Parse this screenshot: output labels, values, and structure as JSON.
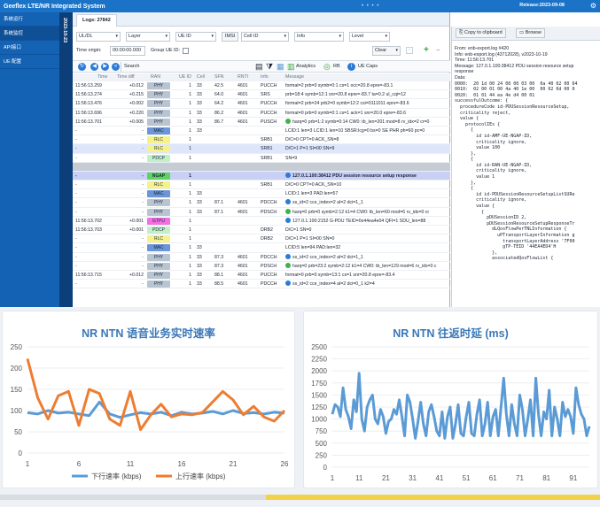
{
  "app": {
    "title": "Geeflex LTE/NR Integrated System",
    "release": "Release:2023-09-08",
    "title_dots": "• • • •"
  },
  "sidebar": {
    "items": [
      {
        "label": "系统运行"
      },
      {
        "label": "系统监控",
        "active": true
      },
      {
        "label": "API接口"
      },
      {
        "label": "UE 配置"
      }
    ]
  },
  "date_strip": "2023-10-23",
  "tab": {
    "label": "Logs: 27842"
  },
  "filters": {
    "uldl": "UL/DL",
    "layer": "Layer",
    "ue_id": "UE ID",
    "imsi_label": "IMSI",
    "cell_id": "Cell ID",
    "info": "Info",
    "level": "Level"
  },
  "time_origin": {
    "label": "Time origin:",
    "value": "00:00:00.000",
    "group_label": "Group UE ID:",
    "clear": "Clear"
  },
  "toolbar": {
    "search": "Search",
    "analytics": "Analytics",
    "rb": "RB",
    "ue_caps": "UE Caps"
  },
  "table": {
    "columns": [
      "Time",
      "Time diff",
      "RAN",
      "UE ID",
      "Cell",
      "SFN",
      "RNTI",
      "Info",
      "Message"
    ],
    "layer_colors": {
      "PHY": "#b9c4d2",
      "MAC": "#6b95d6",
      "RLC": "#f5f28e",
      "PDCP": "#c1f0c8",
      "NGAP": "#5ed45e",
      "GTPU": "#f26ee2"
    },
    "rows": [
      {
        "time": "11:56:13.259",
        "diff": "+0.012",
        "ran": "PHY",
        "ue": "1",
        "cell": "33",
        "sfn": "42.5",
        "rnti": "4601",
        "info": "PUCCH",
        "msg": "format=2 prb=0 symb=0:1 cs=1 occ=20.8 epre=-83.1"
      },
      {
        "time": "11:56:13.274",
        "diff": "+0.215",
        "ran": "PHY",
        "ue": "1",
        "cell": "33",
        "sfn": "64.0",
        "rnti": "4601",
        "info": "SRS",
        "msg": "prb=18:4 symb=12:1 snr=20.8 epre=-83.7 ta=0.2 ul_cqi=12"
      },
      {
        "time": "11:56:13.476",
        "diff": "+0.002",
        "ran": "PHY",
        "ue": "1",
        "cell": "33",
        "sfn": "64.2",
        "rnti": "4601",
        "info": "PUCCH",
        "msg": "format=2 prb=24 prb2=0 symb=12:2 csi=0111011 epre=-83.6"
      },
      {
        "time": "11:56:13.696",
        "diff": "+0.220",
        "ran": "PHY",
        "ue": "1",
        "cell": "33",
        "sfn": "86.2",
        "rnti": "4601",
        "info": "PUCCH",
        "msg": "format=0 prb=0 symb=0:1 cs=1 ack=1 snr=20.0 epre=-83.6"
      },
      {
        "time": "11:56:13.701",
        "diff": "+0.005",
        "ran": "PHY",
        "ue": "1",
        "cell": "33",
        "sfn": "86.7",
        "rnti": "4601",
        "info": "PUSCH",
        "msg": "harq=0 prb=1:2 symb=0:14 CW0: tb_len=201 mod=8 rv_idx=2 cr=0",
        "mi": "#3cb44b"
      },
      {
        "time": "-",
        "diff": "-",
        "ran": "MAC",
        "ue": "1",
        "cell": "33",
        "sfn": "",
        "rnti": "",
        "info": "",
        "msg": "LCID:1 len=3 LCID:1 len=10 SBSR:lcg=0 bs=0 SE PHR ph=60 pc=0"
      },
      {
        "time": "-",
        "diff": "-",
        "ran": "RLC",
        "ue": "1",
        "cell": "",
        "sfn": "",
        "rnti": "",
        "info": "SRB1",
        "msg": "D/C=0 CPT=0 ACK_SN=8"
      },
      {
        "time": "-",
        "diff": "-",
        "ran": "RLC",
        "ue": "1",
        "cell": "",
        "sfn": "",
        "rnti": "",
        "info": "SRB1",
        "msg": "D/C=1 P=1 SI=00 SN=9",
        "sel": true
      },
      {
        "time": "-",
        "diff": "-",
        "ran": "PDCP",
        "ue": "1",
        "cell": "",
        "sfn": "",
        "rnti": "",
        "info": "SRB1",
        "msg": "SN=9"
      },
      {
        "blank": true
      },
      {
        "time": "-",
        "diff": "-",
        "ran": "NGAP",
        "ue": "1",
        "cell": "",
        "sfn": "",
        "rnti": "",
        "info": "",
        "msg": "127.0.1.100:38412 PDU session resource setup response",
        "mi": "#2b7bd6",
        "hl": true
      },
      {
        "time": "-",
        "diff": "-",
        "ran": "RLC",
        "ue": "1",
        "cell": "",
        "sfn": "",
        "rnti": "",
        "info": "SRB1",
        "msg": "D/C=0 CPT=0 ACK_SN=10"
      },
      {
        "time": "-",
        "diff": "-",
        "ran": "MAC",
        "ue": "1",
        "cell": "33",
        "sfn": "",
        "rnti": "",
        "info": "",
        "msg": "LCID:1 len=3 PAD:len=57"
      },
      {
        "time": "-",
        "diff": "-",
        "ran": "PHY",
        "ue": "1",
        "cell": "33",
        "sfn": "87.1",
        "rnti": "4601",
        "info": "PDCCH",
        "msg": "ss_id=2 cce_index=2 al=2 dci=1_1",
        "mi": "#2b7bd6"
      },
      {
        "time": "-",
        "diff": "-",
        "ran": "PHY",
        "ue": "1",
        "cell": "33",
        "sfn": "87.1",
        "rnti": "4601",
        "info": "PDSCH",
        "msg": "harq=0 prb=0 symb=2:12 k1=4 CW0: tb_len=60 mod=6 rv_idx=0 cr",
        "mi": "#3cb44b"
      },
      {
        "time": "11:56:13.702",
        "diff": "+0.001",
        "ran": "GTPU",
        "ue": "1",
        "cell": "",
        "sfn": "",
        "rnti": "",
        "info": "",
        "msg": "127.0.1.100:2152 G-PDU TEID=0x44ea4e04 QFI=1 SDU_len=88",
        "mi": "#2b7bd6"
      },
      {
        "time": "11:56:13.703",
        "diff": "+0.001",
        "ran": "PDCP",
        "ue": "1",
        "cell": "",
        "sfn": "",
        "rnti": "",
        "info": "DRB2",
        "msg": "D/C=1 SN=0"
      },
      {
        "time": "-",
        "diff": "-",
        "ran": "RLC",
        "ue": "1",
        "cell": "",
        "sfn": "",
        "rnti": "",
        "info": "DRB2",
        "msg": "D/C=1 P=1 SI=00 SN=0"
      },
      {
        "time": "-",
        "diff": "-",
        "ran": "MAC",
        "ue": "1",
        "cell": "33",
        "sfn": "",
        "rnti": "",
        "info": "",
        "msg": "LCID:5 len=94 PAD:len=32"
      },
      {
        "time": "-",
        "diff": "-",
        "ran": "PHY",
        "ue": "1",
        "cell": "33",
        "sfn": "87.3",
        "rnti": "4601",
        "info": "PDCCH",
        "msg": "ss_id=2 cce_index=2 al=2 dci=1_1",
        "mi": "#2b7bd6"
      },
      {
        "time": "-",
        "diff": "-",
        "ran": "PHY",
        "ue": "1",
        "cell": "33",
        "sfn": "87.3",
        "rnti": "4601",
        "info": "PDSCH",
        "msg": "harq=0 prb=23:2 symb=2:12 k1=4 CW0: tb_len=129 mod=6 rv_idx=0 c",
        "mi": "#3cb44b"
      },
      {
        "time": "11:56:13.715",
        "diff": "+0.012",
        "ran": "PHY",
        "ue": "1",
        "cell": "33",
        "sfn": "88.1",
        "rnti": "4601",
        "info": "PUCCH",
        "msg": "format=0 prb=0 symb=13:1 cs=1 snr=20.8 epre=-83.4"
      },
      {
        "time": "-",
        "diff": "-",
        "ran": "PHY",
        "ue": "1",
        "cell": "33",
        "sfn": "88.5",
        "rnti": "4601",
        "info": "PDCCH",
        "msg": "ss_id=2 cce_index=4 al=2 dci=0_1 k2=4",
        "mi": "#2b7bd6"
      }
    ]
  },
  "detail": {
    "copy": "Copy to clipboard",
    "browse": "Browse",
    "lines": [
      "From: enb-export.log #420",
      "Info: enb-export.log (43712028), v2023-10-19",
      "Time: 11:56:13.701",
      "Message: 127.0.1.100:38412 PDU session resource setup",
      "response",
      "",
      "Data:",
      "",
      "0000:  20 1d 00 24 00 00 03 00  0a 40 02 00 64",
      "0010:  02 00 01 00 4a 40 1e 00  00 02 0d 00 0",
      "0020:  01 01 44 ea 4e d4 00 01",
      "successfulOutcome: {",
      "  procedureCode id-PDUSessionResourceSetup,",
      "  criticality reject,",
      "  value {",
      "    protocolIEs {",
      "      {",
      "        id id-AMF-UE-NGAP-ID,",
      "        criticality ignore,",
      "        value 100",
      "      },",
      "      {",
      "        id id-RAN-UE-NGAP-ID,",
      "        criticality ignore,",
      "        value 1",
      "      },",
      "      {",
      "        id id-PDUSessionResourceSetupListSURe",
      "        criticality ignore,",
      "        value {",
      "          {",
      "            pDUSessionID 2,",
      "            pDUSessionResourceSetupResponseTr",
      "              dLQosFlowPerTNLInformation {",
      "                uPTransportLayerInformation g",
      "                  transportLayerAddress '7F00",
      "                  gTP-TEID '44EA4ED4'H",
      "              },",
      "              associatedQosFlowList {"
    ]
  },
  "charts": [
    {
      "title": "NR NTN 语音业务实时速率",
      "chart_data": {
        "type": "line",
        "x": [
          1,
          2,
          3,
          4,
          5,
          6,
          7,
          8,
          9,
          10,
          11,
          12,
          13,
          14,
          15,
          16,
          17,
          18,
          19,
          20,
          21,
          22,
          23,
          24,
          25,
          26
        ],
        "ylim": [
          0,
          250
        ],
        "yticks": [
          0,
          50,
          100,
          150,
          200,
          250
        ],
        "xticks": [
          1,
          6,
          11,
          16,
          21,
          26
        ],
        "legend": "bottom",
        "series": [
          {
            "name": "下行速率 (kbps)",
            "color": "#5b9bd5",
            "values": [
              95,
              92,
              100,
              94,
              96,
              92,
              88,
              120,
              92,
              84,
              90,
              95,
              92,
              96,
              88,
              96,
              92,
              94,
              98,
              92,
              100,
              93,
              95,
              92,
              96,
              94
            ]
          },
          {
            "name": "上行速率 (kbps)",
            "color": "#ed7d31",
            "values": [
              222,
              130,
              80,
              135,
              145,
              65,
              150,
              140,
              80,
              65,
              145,
              55,
              90,
              115,
              85,
              92,
              90,
              95,
              120,
              145,
              125,
              90,
              110,
              85,
              75,
              100
            ]
          }
        ]
      }
    },
    {
      "title": "NR NTN 往返时延 (ms)",
      "chart_data": {
        "type": "line",
        "ylim": [
          0,
          2500
        ],
        "yticks": [
          0,
          250,
          500,
          750,
          1000,
          1250,
          1500,
          1750,
          2000,
          2250,
          2500
        ],
        "xticks": [
          1,
          11,
          21,
          31,
          41,
          51,
          61,
          71,
          81,
          91
        ],
        "series": [
          {
            "name": "",
            "color": "#5b9bd5",
            "values": [
              1100,
              1300,
              1250,
              1050,
              1650,
              1200,
              1050,
              800,
              1400,
              1150,
              1950,
              1000,
              750,
              1250,
              1400,
              1500,
              1000,
              900,
              1200,
              1050,
              700,
              950,
              1000,
              1200,
              1100,
              1400,
              1050,
              650,
              1500,
              1350,
              1000,
              600,
              950,
              1350,
              900,
              650,
              1150,
              1300,
              1050,
              750,
              650,
              1150,
              600,
              1050,
              1250,
              600,
              900,
              1300,
              700,
              650,
              1050,
              1350,
              700,
              650,
              1100,
              1400,
              650,
              900,
              1350,
              650,
              1050,
              1200,
              650,
              1250,
              1850,
              1100,
              650,
              1300,
              900,
              650,
              1500,
              1200,
              650,
              1000,
              1400,
              650,
              1850,
              1100,
              650,
              1150,
              1000,
              1600,
              650,
              1250,
              1000,
              650,
              1350,
              1050,
              1200,
              1050,
              700,
              1650,
              1300,
              1100,
              1000,
              650,
              850
            ]
          }
        ]
      }
    }
  ]
}
